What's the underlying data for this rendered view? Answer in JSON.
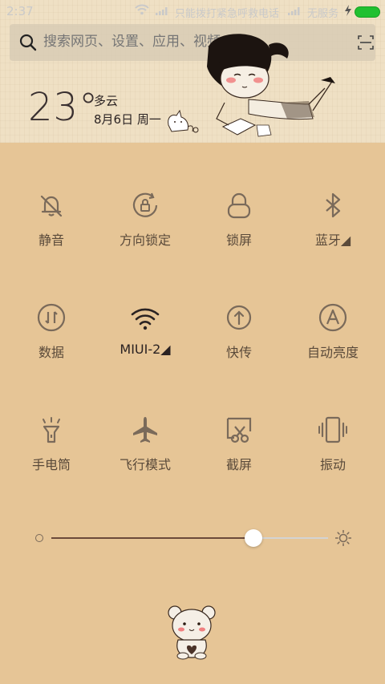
{
  "status_bar": {
    "time": "2:37",
    "emergency_text": "只能拨打紧急呼救电话",
    "no_service": "无服务",
    "battery_color": "#20c030"
  },
  "search": {
    "placeholder": "搜索网页、设置、应用、视频..."
  },
  "weather": {
    "temperature": "23°",
    "condition": "多云",
    "date": "8月6日 周一"
  },
  "tiles": [
    {
      "label": "静音",
      "icon": "bell-off-icon"
    },
    {
      "label": "方向锁定",
      "icon": "rotation-lock-icon"
    },
    {
      "label": "锁屏",
      "icon": "lock-icon"
    },
    {
      "label": "蓝牙◢",
      "icon": "bluetooth-icon"
    },
    {
      "label": "数据",
      "icon": "data-icon"
    },
    {
      "label": "MIUI-2◢",
      "icon": "wifi-icon"
    },
    {
      "label": "快传",
      "icon": "transfer-icon"
    },
    {
      "label": "自动亮度",
      "icon": "auto-brightness-icon"
    },
    {
      "label": "手电筒",
      "icon": "flashlight-icon"
    },
    {
      "label": "飞行模式",
      "icon": "airplane-icon"
    },
    {
      "label": "截屏",
      "icon": "screenshot-icon"
    },
    {
      "label": "振动",
      "icon": "vibrate-icon"
    }
  ],
  "brightness": {
    "level": 0.73,
    "fill_color": "#6b4a3a",
    "track_color": "#d3d3d3"
  },
  "colors": {
    "background": "#e6c596",
    "icon": "#7a6a5a"
  }
}
